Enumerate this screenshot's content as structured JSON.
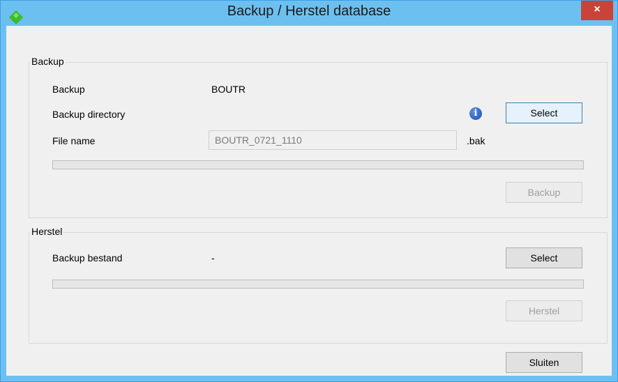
{
  "window": {
    "title": "Backup / Herstel database",
    "close_glyph": "×",
    "app_icon": "green-diamond-icon"
  },
  "backup_group": {
    "title": "Backup",
    "backup_label": "Backup",
    "backup_value": "BOUTR",
    "directory_label": "Backup directory",
    "info_glyph": "i",
    "select_label": "Select",
    "filename_label": "File name",
    "filename_value": "BOUTR_0721_1110",
    "extension": ".bak",
    "progress": 0,
    "backup_button": "Backup"
  },
  "restore_group": {
    "title": "Herstel",
    "bestand_label": "Backup bestand",
    "bestand_value": "-",
    "select_label": "Select",
    "progress": 0,
    "restore_button": "Herstel"
  },
  "footer": {
    "close_button": "Sluiten"
  }
}
